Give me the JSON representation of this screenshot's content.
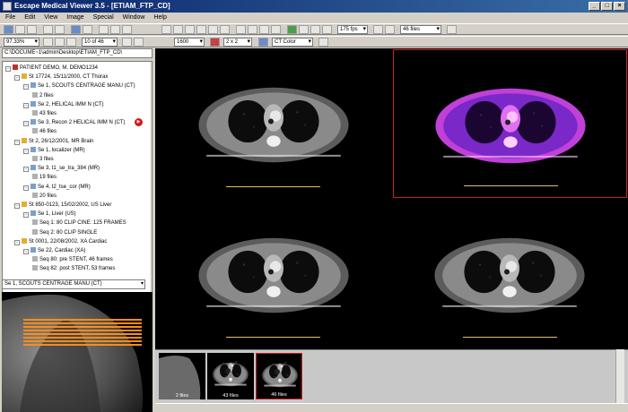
{
  "window": {
    "title": "Escape Medical Viewer 3.5 - [ETIAM_FTP_CD]"
  },
  "menu": [
    "File",
    "Edit",
    "View",
    "Image",
    "Special",
    "Window",
    "Help"
  ],
  "toolbar": {
    "zoom_value": "97.33%",
    "frame_value": "10 of 46",
    "window_preset": "1600",
    "layout_value": "2 x 2",
    "lut_value": "CT Color",
    "zoom2_value": "175 fps",
    "series_value": "46 files"
  },
  "left": {
    "path": "C:\\DOCUME~1\\admin\\Desktop\\ETIAM_FTP_CD\\",
    "tree": [
      {
        "level": 0,
        "type": "patient",
        "expand": "-",
        "label": "PATIENT DEMO, M. DEMO1234"
      },
      {
        "level": 1,
        "type": "study",
        "expand": "-",
        "label": "St 17724, 15/11/2000, CT Thorax"
      },
      {
        "level": 2,
        "type": "series",
        "expand": "-",
        "label": "Se 1, SCOUTS CENTRAGE MANU (CT)"
      },
      {
        "level": 3,
        "type": "image",
        "expand": "",
        "label": "2 files"
      },
      {
        "level": 2,
        "type": "series",
        "expand": "-",
        "label": "Se 2, HELICAL IMM N (CT)"
      },
      {
        "level": 3,
        "type": "image",
        "expand": "",
        "label": "43 files"
      },
      {
        "level": 2,
        "type": "series",
        "expand": "-",
        "label": "Se 3, Recon 2 HELICAL IMM N (CT)"
      },
      {
        "level": 3,
        "type": "image",
        "expand": "",
        "label": "46 files"
      },
      {
        "level": 1,
        "type": "study",
        "expand": "-",
        "label": "St 2, 26/12/2001, MR Brain"
      },
      {
        "level": 2,
        "type": "series",
        "expand": "-",
        "label": "Se 1, localizer (MR)"
      },
      {
        "level": 3,
        "type": "image",
        "expand": "",
        "label": "3 files"
      },
      {
        "level": 2,
        "type": "series",
        "expand": "-",
        "label": "Se 3, t1_se_tra_384 (MR)"
      },
      {
        "level": 3,
        "type": "image",
        "expand": "",
        "label": "19 files"
      },
      {
        "level": 2,
        "type": "series",
        "expand": "-",
        "label": "Se 4, t2_tse_cor (MR)"
      },
      {
        "level": 3,
        "type": "image",
        "expand": "",
        "label": "20 files"
      },
      {
        "level": 1,
        "type": "study",
        "expand": "-",
        "label": "St 850-0123, 15/02/2002, US Liver"
      },
      {
        "level": 2,
        "type": "series",
        "expand": "-",
        "label": "Se 1, Liver (US)"
      },
      {
        "level": 3,
        "type": "image",
        "expand": "",
        "label": "Seq 1: 80 CLIP CINE: 125 FRAMES"
      },
      {
        "level": 3,
        "type": "image",
        "expand": "",
        "label": "Seq 2: 80 CLIP SINGLE"
      },
      {
        "level": 1,
        "type": "study",
        "expand": "-",
        "label": "St 0001, 22/08/2002, XA Cardiac"
      },
      {
        "level": 2,
        "type": "series",
        "expand": "-",
        "label": "Se 22, Cardiac (XA)"
      },
      {
        "level": 3,
        "type": "image",
        "expand": "",
        "label": "Seq 80: pre STENT, 46 frames"
      },
      {
        "level": 3,
        "type": "image",
        "expand": "",
        "label": "Seq 82: post STENT, 53 frames"
      }
    ],
    "series_select": "Se 1, SCOUTS CENTRAGE MANU (CT)"
  },
  "viewports": [
    {
      "patient": "PATIENT DEMO",
      "id": "M, DEMO1234",
      "study": "St 17724",
      "series": "Se 3",
      "image": "Im 9",
      "institution": "DEMONSTRATION",
      "loc": "Slice Loc: -58.50",
      "thick": "Slice Thickness: 3",
      "wl": "C: 0, W: 1600",
      "orientation": "A",
      "scale": "20 cm",
      "color": false,
      "selected": false
    },
    {
      "patient": "PATIENT DEMO",
      "id": "M, DEMO1234",
      "study": "St 17724",
      "series": "Se 3",
      "image": "Im 10",
      "institution": "DEMONSTRATION",
      "loc": "Slice Loc: -62.50",
      "thick": "Slice Thickness: 3",
      "wl": "C: 0, W: 1600",
      "orientation": "A",
      "scale": "20 cm",
      "color": true,
      "selected": true
    },
    {
      "patient": "PATIENT DEMO",
      "id": "M, DEMO1234",
      "study": "St 17724",
      "series": "Se 3",
      "image": "Im 11",
      "institution": "DEMONSTRATION",
      "loc": "Slice Loc: -64.50",
      "thick": "Slice Thickness: 3",
      "wl": "C: 0, W: 1600",
      "orientation": "A",
      "scale": "20 cm",
      "color": false,
      "selected": false
    },
    {
      "patient": "PATIENT DEMO",
      "id": "M, DEMO1234",
      "study": "St 17724",
      "series": "Se 3",
      "image": "Im 12",
      "institution": "DEMONSTRATION",
      "loc": "Slice Loc: -66.50",
      "thick": "Slice Thickness: 3",
      "wl": "C: 0, W: 1600",
      "orientation": "A",
      "scale": "20 cm",
      "color": false,
      "selected": false
    }
  ],
  "thumbnails": [
    {
      "label": "2 files",
      "kind": "scout",
      "selected": false
    },
    {
      "label": "43 files",
      "kind": "axial",
      "selected": false
    },
    {
      "label": "46 files",
      "kind": "axial",
      "selected": true
    }
  ],
  "colors": {
    "overlay": "#e0c060",
    "selection": "#d02020",
    "title": "#0a246a"
  }
}
